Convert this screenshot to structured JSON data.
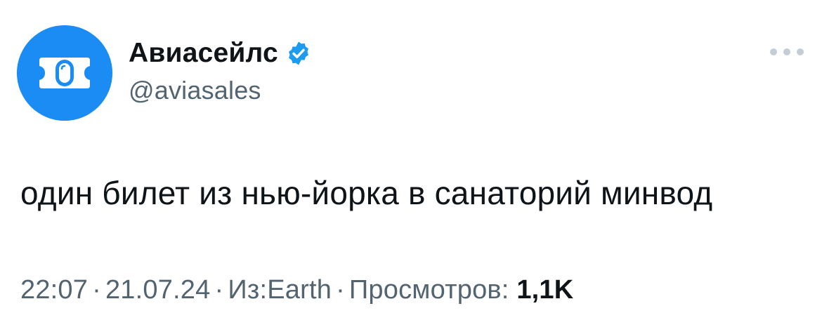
{
  "author": {
    "display_name": "Авиасейлс",
    "handle": "@aviasales",
    "verified": true,
    "avatar_icon": "aviasales-logo-icon",
    "avatar_color": "#1a8cf4"
  },
  "tweet": {
    "text": "один билет из нью-йорка в санаторий минвод"
  },
  "meta": {
    "time": "22:07",
    "date": "21.07.24",
    "location": "Из:Earth",
    "views_label": "Просмотров:",
    "views_count": "1,1K",
    "separator": "·"
  },
  "actions": {
    "more_icon": "more-options-icon"
  },
  "colors": {
    "verified_badge": "#1d9bf0",
    "secondary_text": "#536471",
    "primary_text": "#0f1419"
  }
}
